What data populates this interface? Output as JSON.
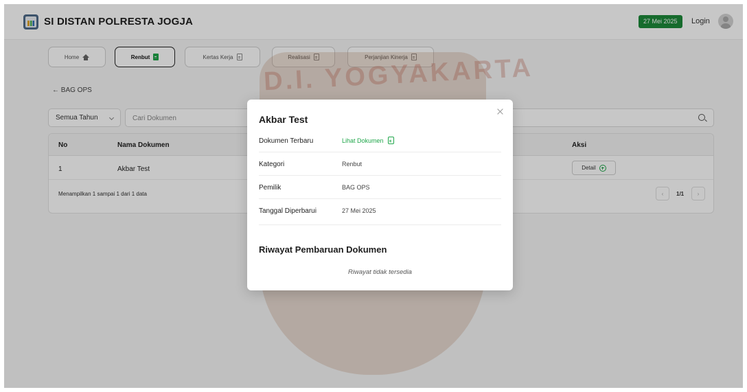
{
  "header": {
    "app_title": "SI DISTAN POLRESTA JOGJA",
    "date_badge": "27 Mei 2025",
    "login_label": "Login"
  },
  "nav": {
    "tabs": [
      {
        "label": "Home",
        "icon": "home-icon",
        "active": false
      },
      {
        "label": "Renbut",
        "icon": "document-icon",
        "active": true
      },
      {
        "label": "Kertas Kerja",
        "icon": "document-icon",
        "active": false
      },
      {
        "label": "Realisasi",
        "icon": "document-icon",
        "active": false
      },
      {
        "label": "Perjanjian Kinerja",
        "icon": "document-icon",
        "active": false
      }
    ]
  },
  "watermark": {
    "text": "D.I. YOGYAKARTA"
  },
  "page": {
    "back_label": "← BAG OPS",
    "year_filter": "Semua Tahun",
    "search_placeholder": "Cari Dokumen"
  },
  "table": {
    "columns": [
      "No",
      "Nama Dokumen",
      "Aksi"
    ],
    "rows": [
      {
        "no": "1",
        "name": "Akbar Test",
        "action": "Detail"
      }
    ],
    "footer": "Menampilkan 1 sampai 1 dari 1 data",
    "pagination": {
      "prev": "‹",
      "page": "1/1",
      "next": "›"
    }
  },
  "modal": {
    "title": "Akbar Test",
    "close": "×",
    "fields": [
      {
        "label": "Dokumen Terbaru",
        "value": "Lihat Dokumen",
        "type": "link"
      },
      {
        "label": "Kategori",
        "value": "Renbut"
      },
      {
        "label": "Pemilik",
        "value": "BAG OPS"
      },
      {
        "label": "Tanggal Diperbarui",
        "value": "27 Mei 2025"
      }
    ],
    "history_title": "Riwayat Pembaruan Dokumen",
    "history_empty": "Riwayat tidak tersedia"
  },
  "colors": {
    "accent_green": "#1fa64a",
    "badge_green": "#1d8a3a"
  }
}
